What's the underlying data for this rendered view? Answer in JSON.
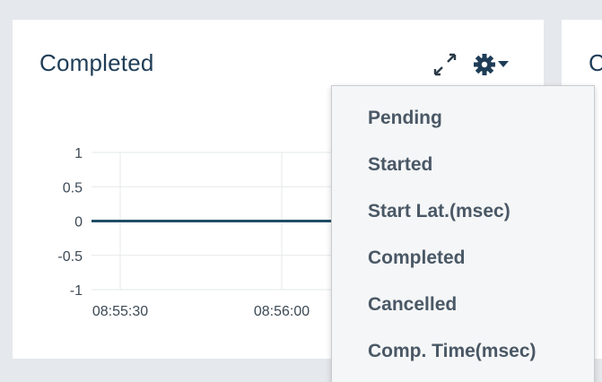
{
  "panel": {
    "title": "Completed",
    "expand_icon": "expand-arrows-icon",
    "settings_icon": "gear-icon",
    "caret_icon": "caret-down-icon"
  },
  "right_panel": {
    "title_partial": "C"
  },
  "dropdown": {
    "items": [
      {
        "label": "Pending"
      },
      {
        "label": "Started"
      },
      {
        "label": "Start Lat.(msec)"
      },
      {
        "label": "Completed"
      },
      {
        "label": "Cancelled"
      },
      {
        "label": "Comp. Time(msec)"
      }
    ]
  },
  "chart_data": {
    "type": "line",
    "x": [
      "08:55:30",
      "08:56:00"
    ],
    "y_ticks": [
      "1",
      "0.5",
      "0",
      "-0.5",
      "-1"
    ],
    "ylim": [
      -1,
      1
    ],
    "series": [
      {
        "values": [
          0,
          0
        ]
      }
    ],
    "grid": true,
    "line_color": "#1f4e66",
    "grid_color": "#e6e8ea"
  },
  "colors": {
    "background": "#e5e8ec",
    "panel": "#ffffff",
    "title": "#1f3d57",
    "menu_text": "#4a5866"
  }
}
